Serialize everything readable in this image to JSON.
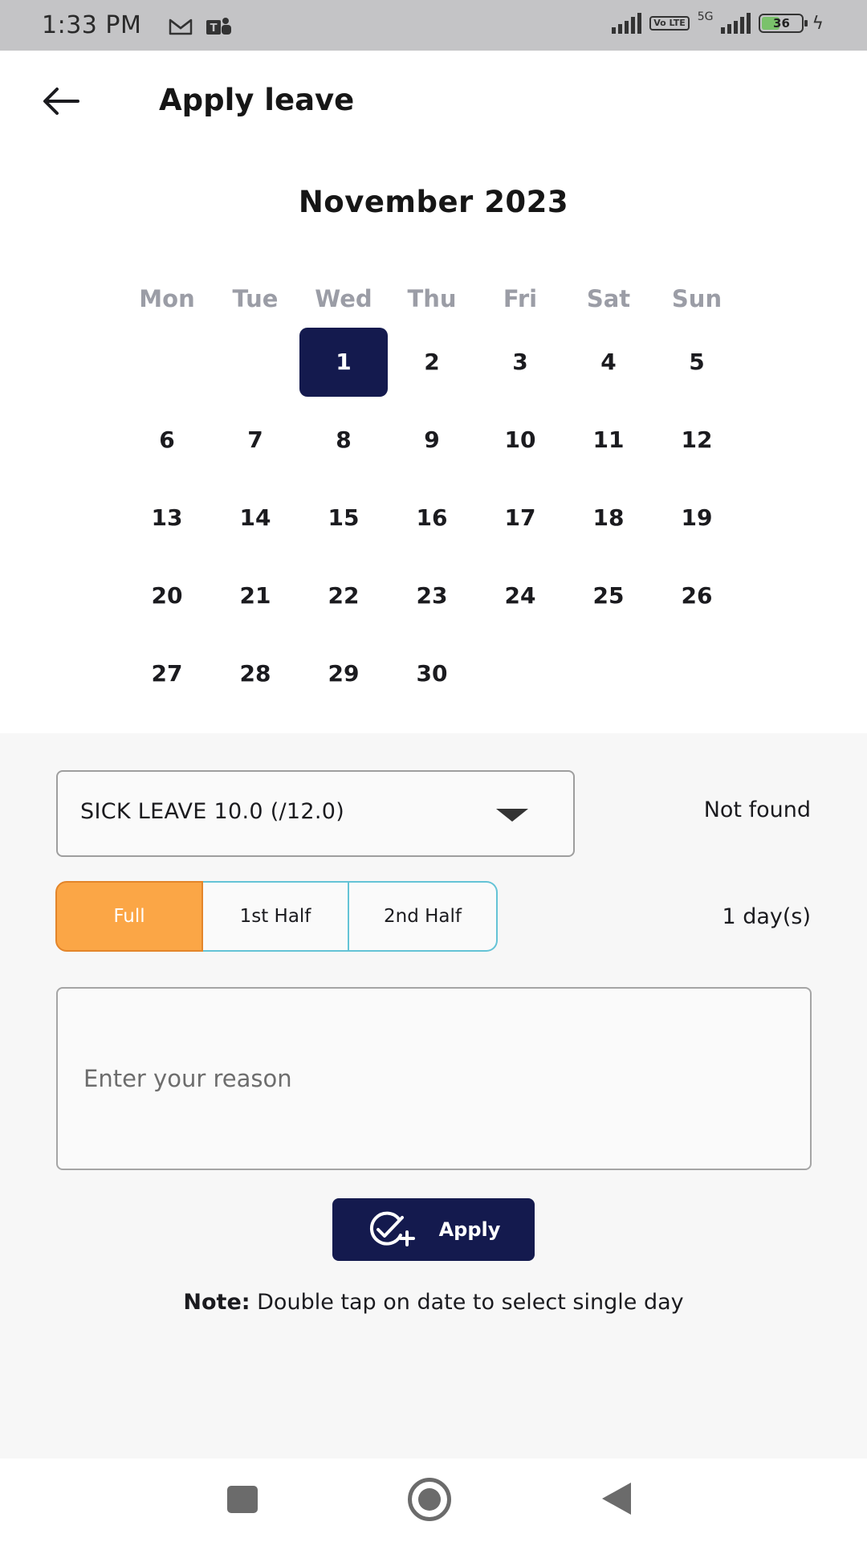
{
  "status_bar": {
    "time": "1:33 PM",
    "battery": "36",
    "network": "5G",
    "volte": "Vo LTE"
  },
  "header": {
    "title": "Apply leave"
  },
  "calendar": {
    "month": "November 2023",
    "weekdays": [
      "Mon",
      "Tue",
      "Wed",
      "Thu",
      "Fri",
      "Sat",
      "Sun"
    ],
    "selected_day": "1",
    "weeks": [
      [
        "",
        "",
        "1",
        "2",
        "3",
        "4",
        "5"
      ],
      [
        "6",
        "7",
        "8",
        "9",
        "10",
        "11",
        "12"
      ],
      [
        "13",
        "14",
        "15",
        "16",
        "17",
        "18",
        "19"
      ],
      [
        "20",
        "21",
        "22",
        "23",
        "24",
        "25",
        "26"
      ],
      [
        "27",
        "28",
        "29",
        "30",
        "",
        "",
        ""
      ]
    ]
  },
  "form": {
    "leave_type": "SICK LEAVE  10.0 (/12.0)",
    "status_text": "Not found",
    "duration_options": [
      "Full",
      "1st Half",
      "2nd Half"
    ],
    "selected_duration": "Full",
    "days_count": "1 day(s)",
    "reason_placeholder": "Enter your reason",
    "reason_value": "",
    "apply_label": "Apply",
    "note_label": "Note:",
    "note_text": " Double tap on date to select single day"
  },
  "colors": {
    "primary": "#141a4e",
    "accent": "#fba646",
    "segment_border": "#64c3d6"
  }
}
